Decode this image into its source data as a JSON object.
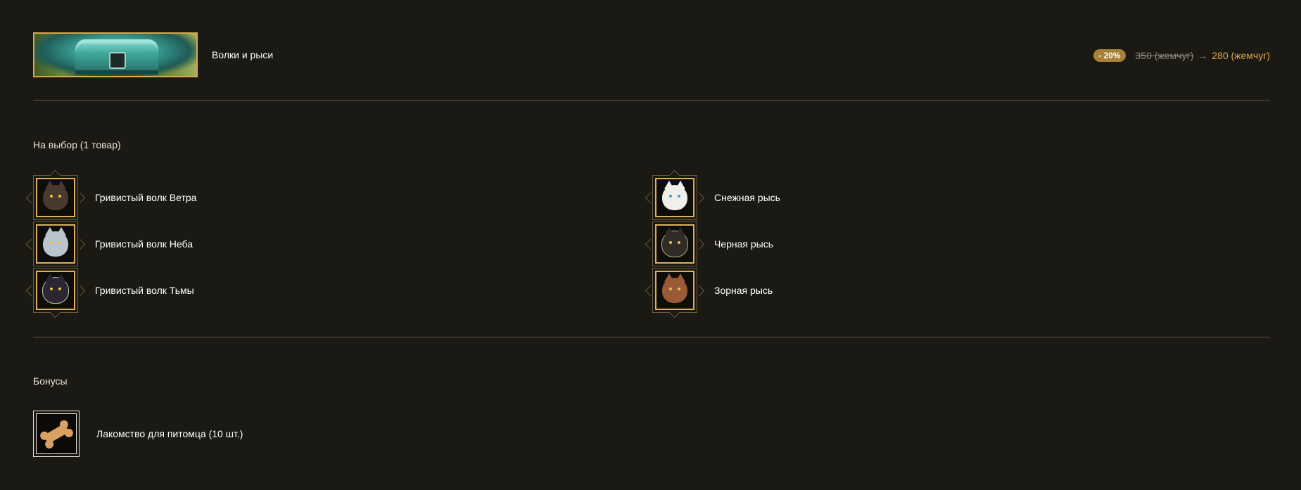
{
  "header": {
    "pack_title": "Волки и рыси",
    "discount": "- 20%",
    "old_price": "350 (жемчуг)",
    "arrow": "→",
    "new_price": "280 (жемчуг)"
  },
  "choice": {
    "title": "На выбор (1 товар)",
    "left_items": [
      {
        "label": "Гривистый волк Ветра",
        "color": "#4a3a2e"
      },
      {
        "label": "Гривистый волк Неба",
        "color": "#b9c4cf"
      },
      {
        "label": "Гривистый волк Тьмы",
        "color": "#1f1d26"
      }
    ],
    "right_items": [
      {
        "label": "Снежная рысь",
        "color": "#f1efe9"
      },
      {
        "label": "Черная рысь",
        "color": "#2f2b28"
      },
      {
        "label": "Зорная рысь",
        "color": "#9a5a35"
      }
    ]
  },
  "bonuses": {
    "title": "Бонусы",
    "items": [
      {
        "label": "Лакомство для питомца (10 шт.)"
      }
    ]
  },
  "colors": {
    "background": "#1b1913",
    "gold": "#d4a84b",
    "price": "#e0a94a"
  }
}
